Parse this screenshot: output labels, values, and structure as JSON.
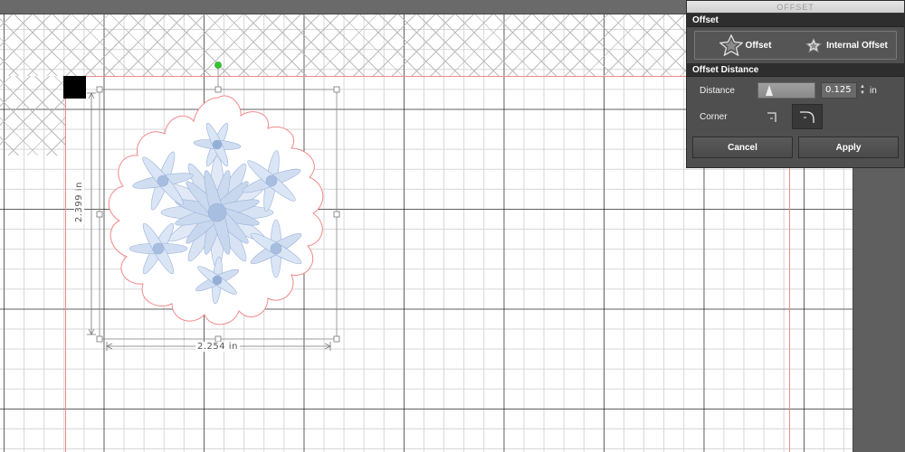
{
  "panel": {
    "title": "OFFSET",
    "section_offset": "Offset",
    "option_offset": "Offset",
    "option_internal": "Internal Offset",
    "section_distance": "Offset Distance",
    "distance_label": "Distance",
    "distance_value": "0.125",
    "distance_unit": "in",
    "corner_label": "Corner",
    "cancel_label": "Cancel",
    "apply_label": "Apply",
    "selected_corner": "round"
  },
  "canvas": {
    "width_dimension": "2.254 in",
    "height_dimension": "2.399 in"
  },
  "colors": {
    "cut_line": "#f08a8a",
    "rotate_handle": "#2ecc2e",
    "flower": "#9fb7dd"
  }
}
